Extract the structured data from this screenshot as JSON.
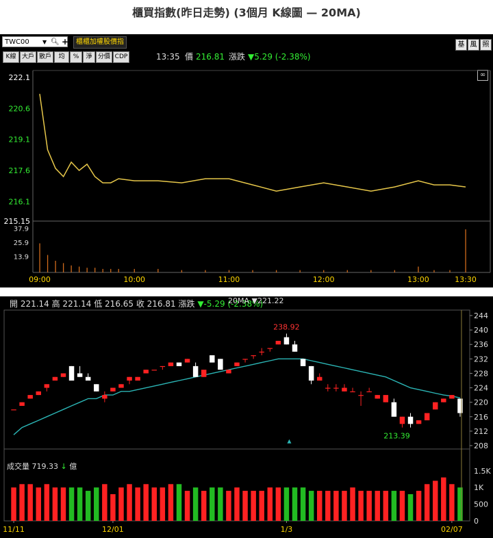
{
  "title": "櫃買指數(昨日走勢) (3個月 K線圖 — 20MA)",
  "intraday": {
    "code": "TWC00",
    "index_name": "櫃櫃加權股價指",
    "buttons": [
      "K線",
      "大戶",
      "散戶",
      "均",
      "%",
      "淨",
      "分價",
      "CDP"
    ],
    "right_buttons": [
      "基",
      "風",
      "照"
    ],
    "time": "13:35",
    "price_label": "價",
    "price": "216.81",
    "change_label": "漲跌",
    "change": "▼5.29 (-2.38%)",
    "y_ticks": [
      "222.1",
      "220.6",
      "219.1",
      "217.6",
      "216.1",
      "215.15"
    ],
    "vol_ticks": [
      "37.9",
      "25.9",
      "13.9"
    ],
    "x_ticks": [
      "09:00",
      "10:00",
      "11:00",
      "12:00",
      "13:00",
      "13:30"
    ]
  },
  "kline": {
    "ohlc_text": "開 221.14 高 221.14 低 216.65 收 216.81 漲跌",
    "change_text": "▼-5.29 (-2.38%)",
    "ma_text": "20MA ▼221.22",
    "high_label": "238.92",
    "low_label": "213.39",
    "y_ticks": [
      "244",
      "240",
      "236",
      "232",
      "228",
      "224",
      "220",
      "216",
      "212",
      "208"
    ],
    "vol_label": "成交量",
    "vol_value": "719.33",
    "vol_arrow": "↓",
    "vol_unit": "億",
    "vol_ticks": [
      "1.5K",
      "1K",
      "500",
      "0"
    ],
    "x_ticks": [
      "11/11",
      "12/01",
      "1/3",
      "02/07"
    ]
  },
  "chart_data": [
    {
      "type": "line",
      "title": "",
      "x": [
        "09:00",
        "09:05",
        "09:10",
        "09:15",
        "09:20",
        "09:25",
        "09:30",
        "09:35",
        "09:40",
        "09:45",
        "09:50",
        "10:00",
        "10:15",
        "10:30",
        "10:45",
        "11:00",
        "11:15",
        "11:30",
        "11:45",
        "12:00",
        "12:15",
        "12:30",
        "12:45",
        "13:00",
        "13:10",
        "13:20",
        "13:30"
      ],
      "y": [
        221.3,
        218.6,
        217.7,
        217.3,
        218.0,
        217.6,
        217.9,
        217.3,
        217.0,
        217.0,
        217.2,
        217.1,
        217.1,
        217.0,
        217.2,
        217.2,
        216.9,
        216.6,
        216.8,
        217.0,
        216.8,
        216.6,
        216.8,
        217.1,
        216.9,
        216.9,
        216.8
      ],
      "ylim": [
        215.15,
        222.1
      ],
      "volume": [
        25,
        15,
        10,
        8,
        6,
        5,
        4,
        4,
        3,
        3,
        3,
        3,
        3,
        2,
        2,
        2,
        2,
        2,
        2,
        2,
        2,
        2,
        2,
        5,
        2,
        2,
        37
      ]
    },
    {
      "type": "candlestick",
      "title": "",
      "categories": [
        "11/11",
        "",
        "",
        "",
        "",
        "",
        "",
        "",
        "",
        "",
        "",
        "",
        "12/01",
        "",
        "",
        "",
        "",
        "",
        "",
        "",
        "",
        "",
        "",
        "",
        "",
        "",
        "",
        "",
        "",
        "",
        "",
        "",
        "",
        "1/3",
        "",
        "",
        "",
        "",
        "",
        "",
        "",
        "",
        "",
        "",
        "",
        "",
        "",
        "",
        "",
        "",
        "",
        "",
        "",
        "",
        "02/07",
        ""
      ],
      "ohlc": [
        [
          218,
          218,
          218,
          218
        ],
        [
          219,
          220,
          219,
          220
        ],
        [
          221,
          222,
          221,
          222
        ],
        [
          222,
          223,
          222,
          223
        ],
        [
          224,
          225,
          223,
          225
        ],
        [
          226,
          227,
          226,
          227
        ],
        [
          227,
          228,
          227,
          228
        ],
        [
          230,
          230,
          226,
          226
        ],
        [
          228,
          230,
          227,
          227
        ],
        [
          227,
          228,
          226,
          226
        ],
        [
          225,
          225,
          223,
          223
        ],
        [
          221,
          223,
          220,
          222
        ],
        [
          223,
          224,
          223,
          224
        ],
        [
          224,
          225,
          224,
          225
        ],
        [
          226,
          227,
          225,
          227
        ],
        [
          226,
          227,
          226,
          227
        ],
        [
          228,
          229,
          228,
          229
        ],
        [
          229,
          229,
          229,
          229
        ],
        [
          230,
          230,
          229,
          230
        ],
        [
          230,
          231,
          230,
          231
        ],
        [
          231,
          231,
          230,
          230
        ],
        [
          231,
          232,
          231,
          232
        ],
        [
          230,
          231,
          227,
          227
        ],
        [
          227,
          229,
          227,
          229
        ],
        [
          233,
          233,
          231,
          231
        ],
        [
          232,
          232,
          229,
          229
        ],
        [
          228,
          229,
          228,
          229
        ],
        [
          230,
          231,
          230,
          231
        ],
        [
          232,
          232,
          231,
          232
        ],
        [
          233,
          233,
          232,
          233
        ],
        [
          234,
          235,
          233,
          234
        ],
        [
          235,
          235,
          234,
          235
        ],
        [
          236,
          237,
          236,
          237
        ],
        [
          238,
          239,
          236,
          236
        ],
        [
          236,
          237,
          234,
          234
        ],
        [
          232,
          232,
          230,
          230
        ],
        [
          230,
          230,
          225,
          226
        ],
        [
          226,
          228,
          226,
          227
        ],
        [
          224,
          225,
          223,
          224
        ],
        [
          224,
          225,
          223,
          224
        ],
        [
          223,
          225,
          223,
          224
        ],
        [
          223,
          224,
          223,
          223
        ],
        [
          222,
          223,
          219,
          222
        ],
        [
          223,
          224,
          223,
          223
        ],
        [
          221,
          222,
          221,
          222
        ],
        [
          220,
          222,
          220,
          222
        ],
        [
          220,
          221,
          216,
          216
        ],
        [
          214,
          216,
          213,
          216
        ],
        [
          216,
          217,
          213,
          214
        ],
        [
          214,
          215,
          214,
          215
        ],
        [
          215,
          217,
          215,
          217
        ],
        [
          218,
          220,
          218,
          220
        ],
        [
          220,
          221,
          220,
          221
        ],
        [
          221,
          222,
          221,
          222
        ],
        [
          221,
          221,
          216,
          217
        ]
      ],
      "ma20": [
        211,
        213,
        214,
        215,
        216,
        217,
        218,
        219,
        220,
        221,
        221,
        222,
        222,
        223,
        223,
        223.5,
        224,
        224.5,
        225,
        225.5,
        226,
        226.5,
        227,
        227.5,
        228,
        228.5,
        229,
        229.5,
        230,
        230.5,
        231,
        231.5,
        232,
        232,
        232,
        232,
        231.5,
        231,
        230.5,
        230,
        229.5,
        229,
        228.5,
        228,
        227.5,
        227,
        226,
        225,
        224,
        223.5,
        223,
        222.5,
        222,
        221.7,
        221.2
      ],
      "volume": [
        1000,
        1100,
        1100,
        1000,
        1100,
        1000,
        1000,
        1000,
        1000,
        900,
        1000,
        1100,
        800,
        1000,
        1100,
        1000,
        1100,
        1000,
        1000,
        1100,
        1100,
        900,
        1000,
        900,
        1000,
        1000,
        900,
        1000,
        900,
        900,
        900,
        1000,
        1000,
        1000,
        1000,
        1000,
        900,
        900,
        900,
        900,
        900,
        1000,
        900,
        900,
        900,
        900,
        900,
        900,
        800,
        900,
        1100,
        1200,
        1300,
        1100,
        1000
      ],
      "ylim": [
        208,
        244
      ]
    }
  ],
  "colors": {
    "up": "#ff2222",
    "down": "#ffffff",
    "ma": "#2bb5b5",
    "line": "#e8c84a",
    "vol_up": "#ff2222",
    "vol_down": "#22bb22",
    "intraday_vol": "#d06b1c"
  }
}
